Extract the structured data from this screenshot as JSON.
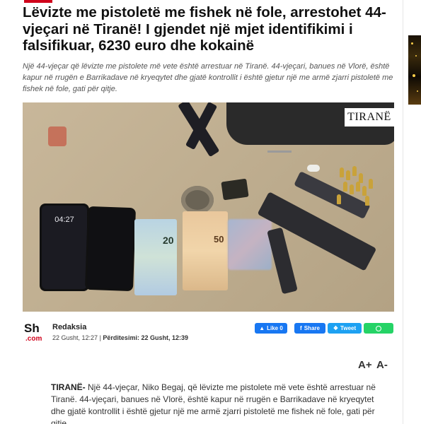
{
  "article": {
    "title": "Lëvizte me pistoletë me fishek në fole, arrestohet 44-vjeçari në Tiranë! I gjendet një mjet identifikimi i falsifikuar, 6230 euro dhe kokainë",
    "lead": "Një 44-vjeçar që lëvizte me pistolete më vete është arrestuar në Tiranë. 44-vjeçari, banues në Vlorë, është kapur në rrugën e Barrikadave në kryeqytet dhe gjatë kontrollit i është gjetur një me armë zjarri pistoletë me fishek në fole, gati për qitje.",
    "image_watermark": "TIRANË",
    "phone_time": "04:27",
    "banknote_20": "20",
    "banknote_50": "50"
  },
  "meta": {
    "logo_sh": "Sh",
    "logo_com": ".com",
    "author": "Redaksia",
    "published": "22 Gusht, 12:27",
    "separator": "|",
    "updated_label": "Përditesimi:",
    "updated": "22 Gusht, 12:39"
  },
  "share": {
    "like_label": "Like 0",
    "share_label": "Share",
    "tweet_label": "Tweet",
    "colors": {
      "facebook": "#1877f2",
      "twitter": "#1da1f2",
      "whatsapp": "#25d366"
    }
  },
  "font_controls": {
    "increase": "A+",
    "decrease": "A-"
  },
  "body": {
    "location": "TIRANË-",
    "text": " Një 44-vjeçar, Niko Begaj, që lëvizte me pistolete më vete është arrestuar në Tiranë. 44-vjeçari, banues në Vlorë, është kapur në rrugën e Barrikadave në kryeqytet dhe gjatë kontrollit i është gjetur një me armë zjarri pistoletë me fishek në fole, gati për qitje."
  },
  "colors": {
    "accent": "#d0021b"
  }
}
